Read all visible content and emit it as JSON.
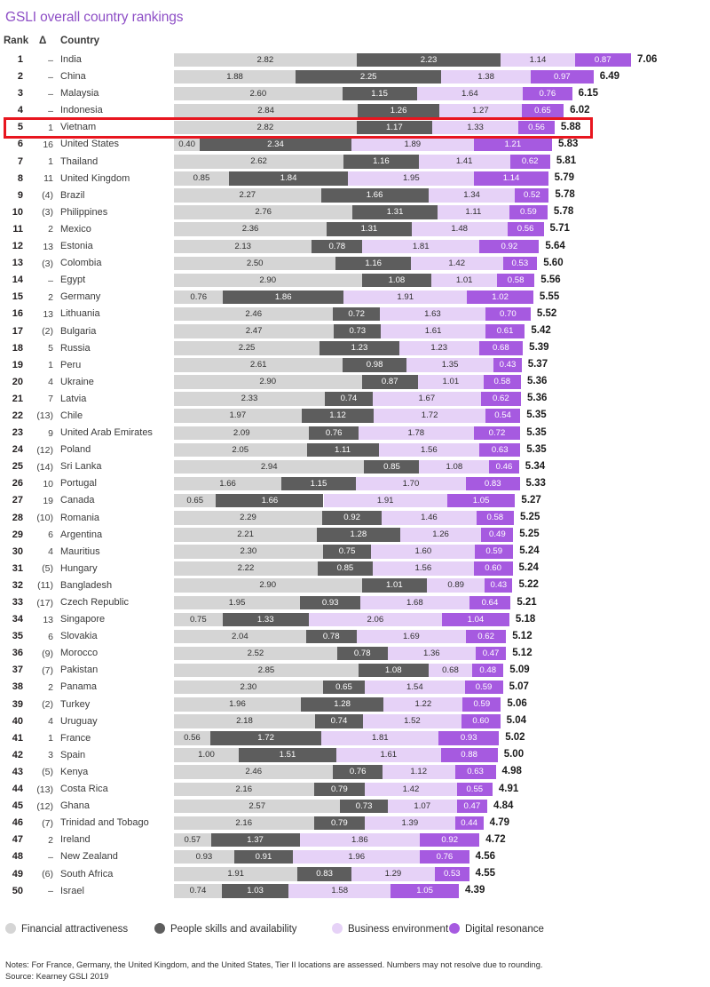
{
  "title": "GSLI overall country rankings",
  "columns": {
    "rank": "Rank",
    "delta": "Δ",
    "country": "Country"
  },
  "colors": {
    "title": "#8e4fc6",
    "financial": "#d5d5d5",
    "people": "#5d5d5d",
    "business": "#e6d2f7",
    "digital": "#a65ae0",
    "highlight": "#e8161f"
  },
  "highlight": {
    "row_rank": 5,
    "country": "Vietnam",
    "border_color": "#e8161f"
  },
  "legend": {
    "items": [
      {
        "label": "Financial attractiveness",
        "color": "#d5d5d5",
        "key": "financial"
      },
      {
        "label": "People skills and availability",
        "color": "#5d5d5d",
        "key": "people"
      },
      {
        "label": "Business environment",
        "color": "#e6d2f7",
        "key": "business"
      },
      {
        "label": "Digital resonance",
        "color": "#a65ae0",
        "key": "digital"
      }
    ]
  },
  "footer": {
    "notes": "Notes: For France, Germany, the United Kingdom, and the United States, Tier II locations are assessed. Numbers may not resolve due to rounding.",
    "source": "Source: Kearney GSLI 2019"
  },
  "chart_data": {
    "type": "bar",
    "orientation": "horizontal",
    "stacked": true,
    "title": "GSLI overall country rankings",
    "xlabel": "",
    "ylabel": "",
    "xlim": [
      0,
      7.06
    ],
    "grid": false,
    "legend_position": "bottom",
    "series": [
      {
        "name": "Financial attractiveness",
        "color": "#d5d5d5"
      },
      {
        "name": "People skills and availability",
        "color": "#5d5d5d"
      },
      {
        "name": "Business environment",
        "color": "#e6d2f7"
      },
      {
        "name": "Digital resonance",
        "color": "#a65ae0"
      }
    ],
    "categories": [
      "India",
      "China",
      "Malaysia",
      "Indonesia",
      "Vietnam",
      "United States",
      "Thailand",
      "United Kingdom",
      "Brazil",
      "Philippines",
      "Mexico",
      "Estonia",
      "Colombia",
      "Egypt",
      "Germany",
      "Lithuania",
      "Bulgaria",
      "Russia",
      "Peru",
      "Ukraine",
      "Latvia",
      "Chile",
      "United Arab Emirates",
      "Poland",
      "Sri Lanka",
      "Portugal",
      "Canada",
      "Romania",
      "Argentina",
      "Mauritius",
      "Hungary",
      "Bangladesh",
      "Czech Republic",
      "Singapore",
      "Slovakia",
      "Morocco",
      "Pakistan",
      "Panama",
      "Turkey",
      "Uruguay",
      "France",
      "Spain",
      "Kenya",
      "Costa Rica",
      "Ghana",
      "Trinidad and Tobago",
      "Ireland",
      "New Zealand",
      "South Africa",
      "Israel"
    ],
    "rows": [
      {
        "rank": "1",
        "delta": "–",
        "country": "India",
        "financial": "2.82",
        "people": "2.23",
        "business": "1.14",
        "digital": "0.87",
        "total": "7.06"
      },
      {
        "rank": "2",
        "delta": "–",
        "country": "China",
        "financial": "1.88",
        "people": "2.25",
        "business": "1.38",
        "digital": "0.97",
        "total": "6.49"
      },
      {
        "rank": "3",
        "delta": "–",
        "country": "Malaysia",
        "financial": "2.60",
        "people": "1.15",
        "business": "1.64",
        "digital": "0.76",
        "total": "6.15"
      },
      {
        "rank": "4",
        "delta": "–",
        "country": "Indonesia",
        "financial": "2.84",
        "people": "1.26",
        "business": "1.27",
        "digital": "0.65",
        "total": "6.02"
      },
      {
        "rank": "5",
        "delta": "1",
        "country": "Vietnam",
        "financial": "2.82",
        "people": "1.17",
        "business": "1.33",
        "digital": "0.56",
        "total": "5.88"
      },
      {
        "rank": "6",
        "delta": "16",
        "country": "United States",
        "financial": "0.40",
        "people": "2.34",
        "business": "1.89",
        "digital": "1.21",
        "total": "5.83"
      },
      {
        "rank": "7",
        "delta": "1",
        "country": "Thailand",
        "financial": "2.62",
        "people": "1.16",
        "business": "1.41",
        "digital": "0.62",
        "total": "5.81"
      },
      {
        "rank": "8",
        "delta": "11",
        "country": "United Kingdom",
        "financial": "0.85",
        "people": "1.84",
        "business": "1.95",
        "digital": "1.14",
        "total": "5.79"
      },
      {
        "rank": "9",
        "delta": "(4)",
        "country": "Brazil",
        "financial": "2.27",
        "people": "1.66",
        "business": "1.34",
        "digital": "0.52",
        "total": "5.78"
      },
      {
        "rank": "10",
        "delta": "(3)",
        "country": "Philippines",
        "financial": "2.76",
        "people": "1.31",
        "business": "1.11",
        "digital": "0.59",
        "total": "5.78"
      },
      {
        "rank": "11",
        "delta": "2",
        "country": "Mexico",
        "financial": "2.36",
        "people": "1.31",
        "business": "1.48",
        "digital": "0.56",
        "total": "5.71"
      },
      {
        "rank": "12",
        "delta": "13",
        "country": "Estonia",
        "financial": "2.13",
        "people": "0.78",
        "business": "1.81",
        "digital": "0.92",
        "total": "5.64"
      },
      {
        "rank": "13",
        "delta": "(3)",
        "country": "Colombia",
        "financial": "2.50",
        "people": "1.16",
        "business": "1.42",
        "digital": "0.53",
        "total": "5.60"
      },
      {
        "rank": "14",
        "delta": "–",
        "country": "Egypt",
        "financial": "2.90",
        "people": "1.08",
        "business": "1.01",
        "digital": "0.58",
        "total": "5.56"
      },
      {
        "rank": "15",
        "delta": "2",
        "country": "Germany",
        "financial": "0.76",
        "people": "1.86",
        "business": "1.91",
        "digital": "1.02",
        "total": "5.55"
      },
      {
        "rank": "16",
        "delta": "13",
        "country": "Lithuania",
        "financial": "2.46",
        "people": "0.72",
        "business": "1.63",
        "digital": "0.70",
        "total": "5.52"
      },
      {
        "rank": "17",
        "delta": "(2)",
        "country": "Bulgaria",
        "financial": "2.47",
        "people": "0.73",
        "business": "1.61",
        "digital": "0.61",
        "total": "5.42"
      },
      {
        "rank": "18",
        "delta": "5",
        "country": "Russia",
        "financial": "2.25",
        "people": "1.23",
        "business": "1.23",
        "digital": "0.68",
        "total": "5.39"
      },
      {
        "rank": "19",
        "delta": "1",
        "country": "Peru",
        "financial": "2.61",
        "people": "0.98",
        "business": "1.35",
        "digital": "0.43",
        "total": "5.37"
      },
      {
        "rank": "20",
        "delta": "4",
        "country": "Ukraine",
        "financial": "2.90",
        "people": "0.87",
        "business": "1.01",
        "digital": "0.58",
        "total": "5.36"
      },
      {
        "rank": "21",
        "delta": "7",
        "country": "Latvia",
        "financial": "2.33",
        "people": "0.74",
        "business": "1.67",
        "digital": "0.62",
        "total": "5.36"
      },
      {
        "rank": "22",
        "delta": "(13)",
        "country": "Chile",
        "financial": "1.97",
        "people": "1.12",
        "business": "1.72",
        "digital": "0.54",
        "total": "5.35"
      },
      {
        "rank": "23",
        "delta": "9",
        "country": "United Arab Emirates",
        "financial": "2.09",
        "people": "0.76",
        "business": "1.78",
        "digital": "0.72",
        "total": "5.35"
      },
      {
        "rank": "24",
        "delta": "(12)",
        "country": "Poland",
        "financial": "2.05",
        "people": "1.11",
        "business": "1.56",
        "digital": "0.63",
        "total": "5.35"
      },
      {
        "rank": "25",
        "delta": "(14)",
        "country": "Sri Lanka",
        "financial": "2.94",
        "people": "0.85",
        "business": "1.08",
        "digital": "0.46",
        "total": "5.34"
      },
      {
        "rank": "26",
        "delta": "10",
        "country": "Portugal",
        "financial": "1.66",
        "people": "1.15",
        "business": "1.70",
        "digital": "0.83",
        "total": "5.33"
      },
      {
        "rank": "27",
        "delta": "19",
        "country": "Canada",
        "financial": "0.65",
        "people": "1.66",
        "business": "1.91",
        "digital": "1.05",
        "total": "5.27"
      },
      {
        "rank": "28",
        "delta": "(10)",
        "country": "Romania",
        "financial": "2.29",
        "people": "0.92",
        "business": "1.46",
        "digital": "0.58",
        "total": "5.25"
      },
      {
        "rank": "29",
        "delta": "6",
        "country": "Argentina",
        "financial": "2.21",
        "people": "1.28",
        "business": "1.26",
        "digital": "0.49",
        "total": "5.25"
      },
      {
        "rank": "30",
        "delta": "4",
        "country": "Mauritius",
        "financial": "2.30",
        "people": "0.75",
        "business": "1.60",
        "digital": "0.59",
        "total": "5.24"
      },
      {
        "rank": "31",
        "delta": "(5)",
        "country": "Hungary",
        "financial": "2.22",
        "people": "0.85",
        "business": "1.56",
        "digital": "0.60",
        "total": "5.24"
      },
      {
        "rank": "32",
        "delta": "(11)",
        "country": "Bangladesh",
        "financial": "2.90",
        "people": "1.01",
        "business": "0.89",
        "digital": "0.43",
        "total": "5.22"
      },
      {
        "rank": "33",
        "delta": "(17)",
        "country": "Czech Republic",
        "financial": "1.95",
        "people": "0.93",
        "business": "1.68",
        "digital": "0.64",
        "total": "5.21"
      },
      {
        "rank": "34",
        "delta": "13",
        "country": "Singapore",
        "financial": "0.75",
        "people": "1.33",
        "business": "2.06",
        "digital": "1.04",
        "total": "5.18"
      },
      {
        "rank": "35",
        "delta": "6",
        "country": "Slovakia",
        "financial": "2.04",
        "people": "0.78",
        "business": "1.69",
        "digital": "0.62",
        "total": "5.12"
      },
      {
        "rank": "36",
        "delta": "(9)",
        "country": "Morocco",
        "financial": "2.52",
        "people": "0.78",
        "business": "1.36",
        "digital": "0.47",
        "total": "5.12"
      },
      {
        "rank": "37",
        "delta": "(7)",
        "country": "Pakistan",
        "financial": "2.85",
        "people": "1.08",
        "business": "0.68",
        "digital": "0.48",
        "total": "5.09"
      },
      {
        "rank": "38",
        "delta": "2",
        "country": "Panama",
        "financial": "2.30",
        "people": "0.65",
        "business": "1.54",
        "digital": "0.59",
        "total": "5.07"
      },
      {
        "rank": "39",
        "delta": "(2)",
        "country": "Turkey",
        "financial": "1.96",
        "people": "1.28",
        "business": "1.22",
        "digital": "0.59",
        "total": "5.06"
      },
      {
        "rank": "40",
        "delta": "4",
        "country": "Uruguay",
        "financial": "2.18",
        "people": "0.74",
        "business": "1.52",
        "digital": "0.60",
        "total": "5.04"
      },
      {
        "rank": "41",
        "delta": "1",
        "country": "France",
        "financial": "0.56",
        "people": "1.72",
        "business": "1.81",
        "digital": "0.93",
        "total": "5.02"
      },
      {
        "rank": "42",
        "delta": "3",
        "country": "Spain",
        "financial": "1.00",
        "people": "1.51",
        "business": "1.61",
        "digital": "0.88",
        "total": "5.00"
      },
      {
        "rank": "43",
        "delta": "(5)",
        "country": "Kenya",
        "financial": "2.46",
        "people": "0.76",
        "business": "1.12",
        "digital": "0.63",
        "total": "4.98"
      },
      {
        "rank": "44",
        "delta": "(13)",
        "country": "Costa Rica",
        "financial": "2.16",
        "people": "0.79",
        "business": "1.42",
        "digital": "0.55",
        "total": "4.91"
      },
      {
        "rank": "45",
        "delta": "(12)",
        "country": "Ghana",
        "financial": "2.57",
        "people": "0.73",
        "business": "1.07",
        "digital": "0.47",
        "total": "4.84"
      },
      {
        "rank": "46",
        "delta": "(7)",
        "country": "Trinidad and Tobago",
        "financial": "2.16",
        "people": "0.79",
        "business": "1.39",
        "digital": "0.44",
        "total": "4.79"
      },
      {
        "rank": "47",
        "delta": "2",
        "country": "Ireland",
        "financial": "0.57",
        "people": "1.37",
        "business": "1.86",
        "digital": "0.92",
        "total": "4.72"
      },
      {
        "rank": "48",
        "delta": "–",
        "country": "New Zealand",
        "financial": "0.93",
        "people": "0.91",
        "business": "1.96",
        "digital": "0.76",
        "total": "4.56"
      },
      {
        "rank": "49",
        "delta": "(6)",
        "country": "South Africa",
        "financial": "1.91",
        "people": "0.83",
        "business": "1.29",
        "digital": "0.53",
        "total": "4.55"
      },
      {
        "rank": "50",
        "delta": "–",
        "country": "Israel",
        "financial": "0.74",
        "people": "1.03",
        "business": "1.58",
        "digital": "1.05",
        "total": "4.39"
      }
    ]
  }
}
